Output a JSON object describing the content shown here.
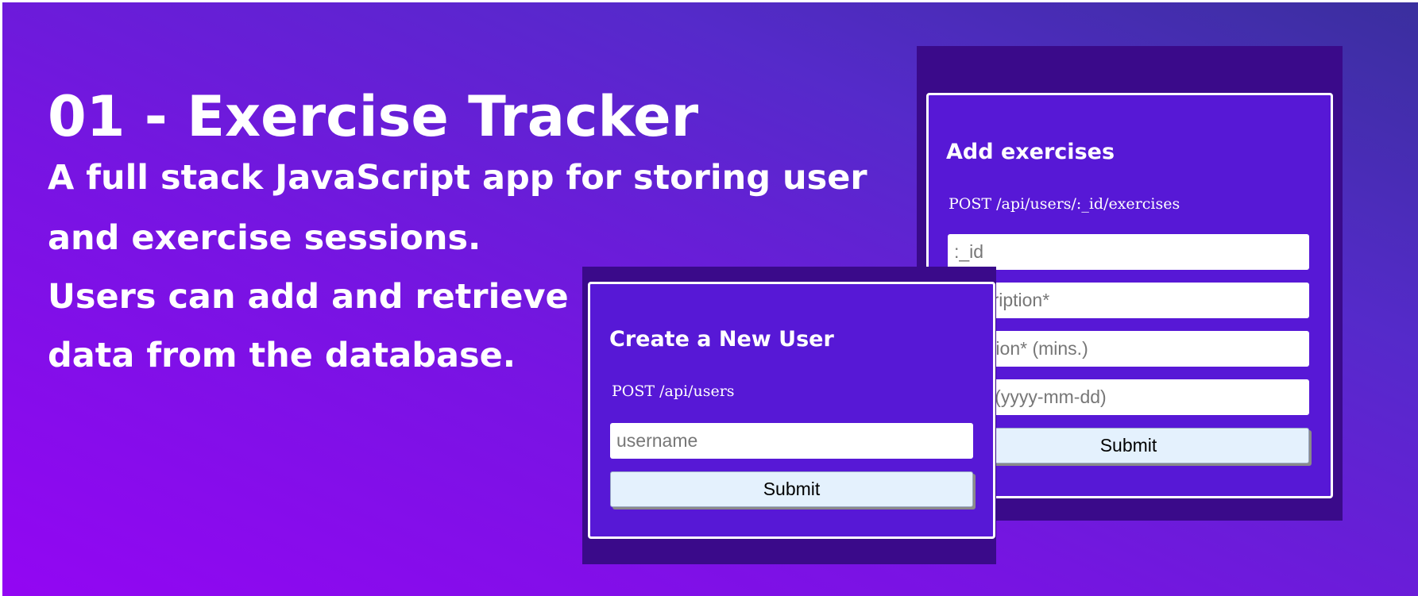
{
  "hero": {
    "title": "01 - Exercise Tracker",
    "description_lines": [
      "A full stack JavaScript app for storing user",
      "and exercise sessions.",
      "Users can add and retrieve",
      "data from the database."
    ]
  },
  "add_exercises": {
    "title": "Add exercises",
    "endpoint": "POST /api/users/:_id/exercises",
    "id_placeholder": ":_id",
    "description_placeholder": "description*",
    "duration_placeholder": "duration* (mins.)",
    "date_placeholder": "date (yyyy-mm-dd)",
    "submit_label": "Submit"
  },
  "create_user": {
    "title": "Create a New User",
    "endpoint": "POST /api/users",
    "username_placeholder": "username",
    "submit_label": "Submit"
  },
  "colors": {
    "gradient_start": "#9306f3",
    "gradient_end": "#3a2f9e",
    "panel_back": "#3a0a8a",
    "card_bg": "#5718d6",
    "submit_bg": "#e4f1fd"
  }
}
